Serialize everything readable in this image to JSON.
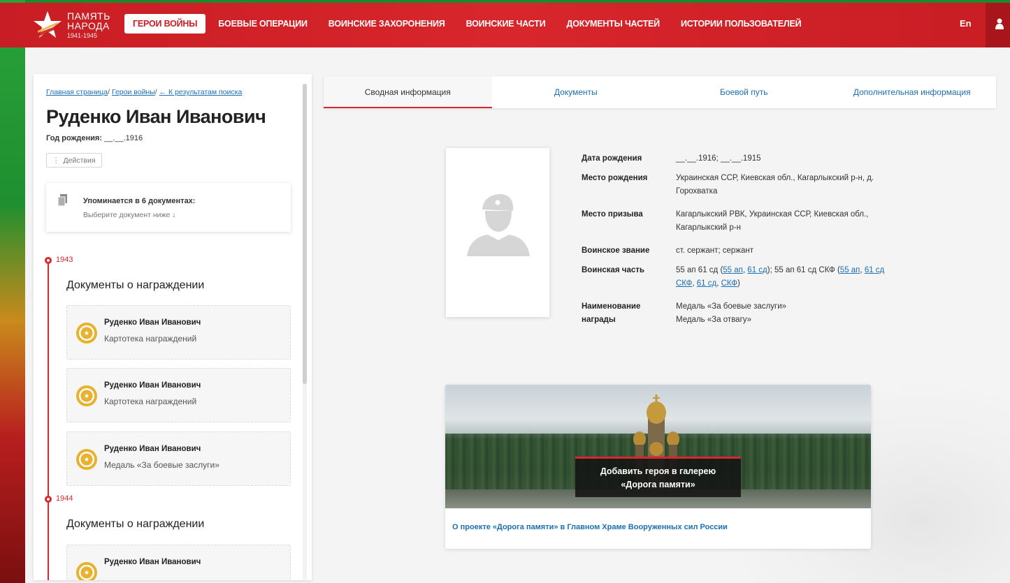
{
  "logo": {
    "line1": "ПАМЯТЬ",
    "line2": "НАРОДА",
    "years": "1941-1945"
  },
  "nav": [
    {
      "label": "ГЕРОИ ВОЙНЫ",
      "active": true
    },
    {
      "label": "БОЕВЫЕ ОПЕРАЦИИ"
    },
    {
      "label": "ВОИНСКИЕ ЗАХОРОНЕНИЯ"
    },
    {
      "label": "ВОИНСКИЕ ЧАСТИ"
    },
    {
      "label": "ДОКУМЕНТЫ ЧАСТЕЙ"
    },
    {
      "label": "ИСТОРИИ ПОЛЬЗОВАТЕЛЕЙ"
    }
  ],
  "lang": "En",
  "breadcrumb": {
    "home": "Главная страница",
    "heroes": "Герои войны",
    "back": "← К результатам поиска"
  },
  "person": {
    "name": "Руденко Иван Иванович",
    "birth_label": "Год рождения:",
    "birth_value": "__.__.1916",
    "actions_label": "Действия"
  },
  "mentions": {
    "title": "Упоминается в 6 документах:",
    "subtitle": "Выберите документ ниже ↓"
  },
  "timeline": [
    {
      "year": "1943",
      "section": "Документы о награждении",
      "docs": [
        {
          "name": "Руденко Иван Иванович",
          "type": "Картотека награждений"
        },
        {
          "name": "Руденко Иван Иванович",
          "type": "Картотека награждений"
        },
        {
          "name": "Руденко Иван Иванович",
          "type": "Медаль «За боевые заслуги»"
        }
      ]
    },
    {
      "year": "1944",
      "section": "Документы о награждении",
      "docs": [
        {
          "name": "Руденко Иван Иванович",
          "type": ""
        }
      ]
    }
  ],
  "tabs": [
    {
      "label": "Сводная информация",
      "active": true
    },
    {
      "label": "Документы"
    },
    {
      "label": "Боевой путь"
    },
    {
      "label": "Дополнительная информация"
    }
  ],
  "info": {
    "birth_date_label": "Дата рождения",
    "birth_date_value": "__.__.1916; __.__.1915",
    "birth_place_label": "Место рождения",
    "birth_place_value": "Украинская ССР, Киевская обл., Кагарлыкский р-н, д. Горохватка",
    "draft_place_label": "Место призыва",
    "draft_place_value": "Кагарлыкский РВК, Украинская ССР, Киевская обл., Кагарлыкский р-н",
    "rank_label": "Воинское звание",
    "rank_value": "ст. сержант; сержант",
    "unit_label": "Воинская часть",
    "unit_text1": "55 ап 61 сд (",
    "unit_link1": "55 ап",
    "unit_sep1": ", ",
    "unit_link2": "61 сд",
    "unit_text2": "); 55 ап 61 сд СКФ (",
    "unit_link3": "55 ап",
    "unit_sep2": ", ",
    "unit_link4": "61 сд СКФ",
    "unit_sep3": ", ",
    "unit_link5": "61 сд",
    "unit_sep4": ", ",
    "unit_link6": "СКФ",
    "unit_text3": ")",
    "award_label": "Наименование награды",
    "award_value1": "Медаль «За боевые заслуги»",
    "award_value2": "Медаль «За отвагу»"
  },
  "banner": {
    "overlay_line1": "Добавить героя в галерею",
    "overlay_line2": "«Дорога памяти»",
    "link": "О проекте «Дорога памяти» в Главном Храме Вооруженных сил России"
  },
  "colors": {
    "brand_red": "#d8262c",
    "link_blue": "#1a6fb5",
    "medal_gold": "#e7b22f"
  }
}
